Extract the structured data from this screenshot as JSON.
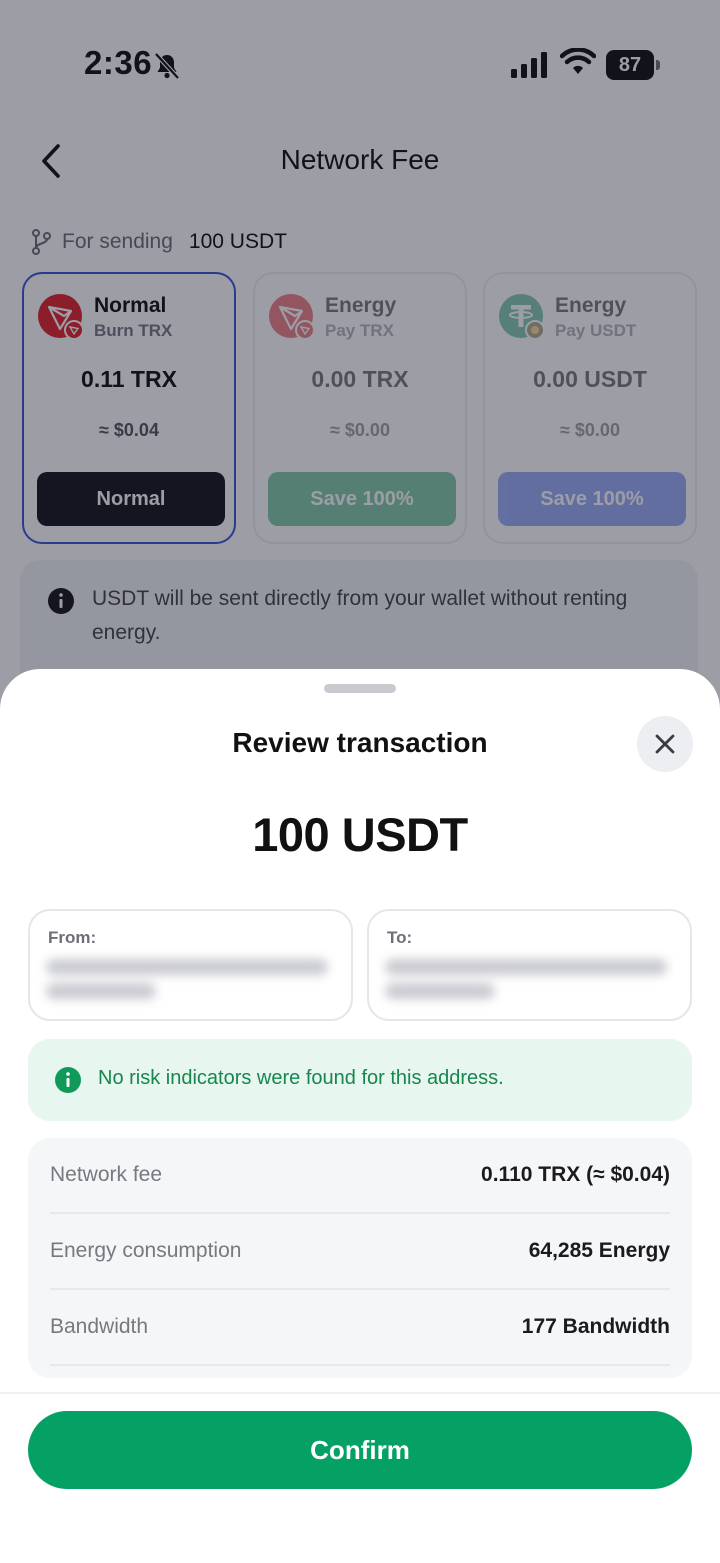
{
  "status_bar": {
    "time": "2:36",
    "battery": "87"
  },
  "header": {
    "title": "Network Fee"
  },
  "sending": {
    "label": "For sending",
    "amount": "100 USDT"
  },
  "fee_options": [
    {
      "name": "Normal",
      "sub": "Burn TRX",
      "amount": "0.11 TRX",
      "usd": "≈ $0.04",
      "button": "Normal",
      "selected": true
    },
    {
      "name": "Energy",
      "sub": "Pay TRX",
      "amount": "0.00 TRX",
      "usd": "≈ $0.00",
      "button": "Save 100%",
      "selected": false
    },
    {
      "name": "Energy",
      "sub": "Pay USDT",
      "amount": "0.00 USDT",
      "usd": "≈ $0.00",
      "button": "Save 100%",
      "selected": false
    }
  ],
  "info": {
    "text": "USDT will be sent directly from your wallet without renting energy."
  },
  "sheet": {
    "title": "Review transaction",
    "amount": "100 USDT",
    "from_label": "From:",
    "to_label": "To:",
    "risk_text": "No risk indicators were found for this address.",
    "details": [
      {
        "label": "Network fee",
        "value": "0.110 TRX (≈ $0.04)"
      },
      {
        "label": "Energy consumption",
        "value": "64,285 Energy"
      },
      {
        "label": "Bandwidth",
        "value": "177 Bandwidth"
      }
    ],
    "confirm_label": "Confirm"
  },
  "colors": {
    "selected_border": "#3b57d8",
    "save_green": "#1fa462",
    "save_blue": "#4f6ef2",
    "confirm_green": "#05a064",
    "risk_bg": "#e7f6ee",
    "risk_text": "#17864f",
    "tron_red": "#e3242b",
    "tether_green": "#26a17b"
  },
  "icons": {
    "back": "chevron-left-icon",
    "bell": "bell-slash-icon",
    "signal": "cellular-signal-icon",
    "wifi": "wifi-icon",
    "fork": "git-branch-icon",
    "tron": "tron-logo-icon",
    "tether": "tether-logo-icon",
    "info": "info-circle-icon",
    "close": "close-icon"
  }
}
